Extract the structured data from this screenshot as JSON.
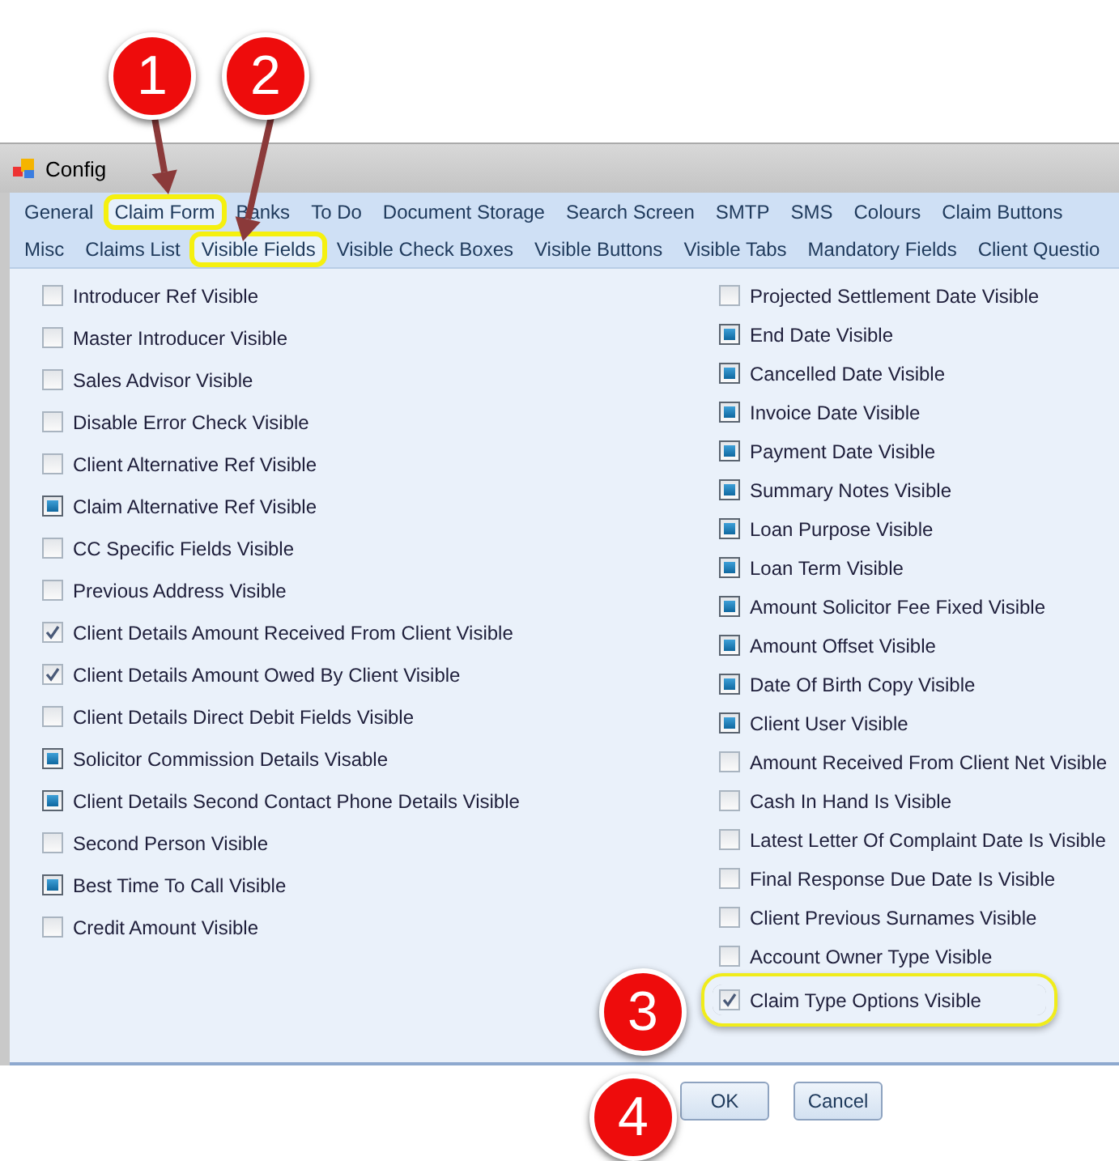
{
  "window": {
    "title": "Config"
  },
  "tab_rows": [
    {
      "tabs": [
        {
          "label": "General",
          "selected": false,
          "highlighted": false
        },
        {
          "label": "Claim Form",
          "selected": true,
          "highlighted": true
        },
        {
          "label": "Banks",
          "selected": false,
          "highlighted": false
        },
        {
          "label": "To Do",
          "selected": false,
          "highlighted": false
        },
        {
          "label": "Document Storage",
          "selected": false,
          "highlighted": false
        },
        {
          "label": "Search Screen",
          "selected": false,
          "highlighted": false
        },
        {
          "label": "SMTP",
          "selected": false,
          "highlighted": false
        },
        {
          "label": "SMS",
          "selected": false,
          "highlighted": false
        },
        {
          "label": "Colours",
          "selected": false,
          "highlighted": false
        },
        {
          "label": "Claim Buttons",
          "selected": false,
          "highlighted": false
        }
      ]
    },
    {
      "tabs": [
        {
          "label": "Misc",
          "selected": false,
          "highlighted": false
        },
        {
          "label": "Claims List",
          "selected": false,
          "highlighted": false
        },
        {
          "label": "Visible Fields",
          "selected": true,
          "highlighted": true
        },
        {
          "label": "Visible Check Boxes",
          "selected": false,
          "highlighted": false
        },
        {
          "label": "Visible Buttons",
          "selected": false,
          "highlighted": false
        },
        {
          "label": "Visible Tabs",
          "selected": false,
          "highlighted": false
        },
        {
          "label": "Mandatory Fields",
          "selected": false,
          "highlighted": false
        },
        {
          "label": "Client Questio",
          "selected": false,
          "highlighted": false
        }
      ]
    }
  ],
  "columns": [
    {
      "options": [
        {
          "label": "Introducer Ref Visible",
          "checked": false,
          "indeterminate": false,
          "highlighted": false
        },
        {
          "label": "Master Introducer Visible",
          "checked": false,
          "indeterminate": false,
          "highlighted": false
        },
        {
          "label": "Sales Advisor Visible",
          "checked": false,
          "indeterminate": false,
          "highlighted": false
        },
        {
          "label": "Disable Error Check Visible",
          "checked": false,
          "indeterminate": false,
          "highlighted": false
        },
        {
          "label": "Client Alternative Ref Visible",
          "checked": false,
          "indeterminate": false,
          "highlighted": false
        },
        {
          "label": "Claim Alternative Ref Visible",
          "checked": false,
          "indeterminate": true,
          "highlighted": false
        },
        {
          "label": "CC Specific Fields Visible",
          "checked": false,
          "indeterminate": false,
          "highlighted": false
        },
        {
          "label": "Previous Address Visible",
          "checked": false,
          "indeterminate": false,
          "highlighted": false
        },
        {
          "label": "Client Details Amount Received From Client Visible",
          "checked": true,
          "indeterminate": false,
          "highlighted": false
        },
        {
          "label": "Client Details Amount Owed By Client Visible",
          "checked": true,
          "indeterminate": false,
          "highlighted": false
        },
        {
          "label": "Client Details Direct Debit Fields Visible",
          "checked": false,
          "indeterminate": false,
          "highlighted": false
        },
        {
          "label": "Solicitor Commission Details Visable",
          "checked": false,
          "indeterminate": true,
          "highlighted": false
        },
        {
          "label": "Client Details Second Contact Phone Details Visible",
          "checked": false,
          "indeterminate": true,
          "highlighted": false
        },
        {
          "label": "Second Person Visible",
          "checked": false,
          "indeterminate": false,
          "highlighted": false
        },
        {
          "label": "Best Time To Call Visible",
          "checked": false,
          "indeterminate": true,
          "highlighted": false
        },
        {
          "label": "Credit Amount Visible",
          "checked": false,
          "indeterminate": false,
          "highlighted": false
        }
      ]
    },
    {
      "options": [
        {
          "label": "Projected Settlement Date Visible",
          "checked": false,
          "indeterminate": false,
          "highlighted": false
        },
        {
          "label": "End Date Visible",
          "checked": false,
          "indeterminate": true,
          "highlighted": false
        },
        {
          "label": "Cancelled Date Visible",
          "checked": false,
          "indeterminate": true,
          "highlighted": false
        },
        {
          "label": "Invoice Date Visible",
          "checked": false,
          "indeterminate": true,
          "highlighted": false
        },
        {
          "label": "Payment Date Visible",
          "checked": false,
          "indeterminate": true,
          "highlighted": false
        },
        {
          "label": "Summary Notes Visible",
          "checked": false,
          "indeterminate": true,
          "highlighted": false
        },
        {
          "label": "Loan Purpose Visible",
          "checked": false,
          "indeterminate": true,
          "highlighted": false
        },
        {
          "label": "Loan Term Visible",
          "checked": false,
          "indeterminate": true,
          "highlighted": false
        },
        {
          "label": "Amount Solicitor Fee Fixed Visible",
          "checked": false,
          "indeterminate": true,
          "highlighted": false
        },
        {
          "label": "Amount Offset Visible",
          "checked": false,
          "indeterminate": true,
          "highlighted": false
        },
        {
          "label": "Date Of Birth Copy Visible",
          "checked": false,
          "indeterminate": true,
          "highlighted": false
        },
        {
          "label": "Client User Visible",
          "checked": false,
          "indeterminate": true,
          "highlighted": false
        },
        {
          "label": "Amount Received From Client Net Visible",
          "checked": false,
          "indeterminate": false,
          "highlighted": false
        },
        {
          "label": "Cash In Hand Is Visible",
          "checked": false,
          "indeterminate": false,
          "highlighted": false
        },
        {
          "label": "Latest Letter Of Complaint Date Is Visible",
          "checked": false,
          "indeterminate": false,
          "highlighted": false
        },
        {
          "label": "Final Response Due Date Is Visible",
          "checked": false,
          "indeterminate": false,
          "highlighted": false
        },
        {
          "label": "Client Previous Surnames Visible",
          "checked": false,
          "indeterminate": false,
          "highlighted": false
        },
        {
          "label": "Account Owner Type Visible",
          "checked": false,
          "indeterminate": false,
          "highlighted": false
        },
        {
          "label": "Claim Type Options Visible",
          "checked": true,
          "indeterminate": false,
          "highlighted": true
        }
      ]
    }
  ],
  "buttons": [
    "OK",
    "Cancel"
  ],
  "callouts": [
    {
      "number": "1"
    },
    {
      "number": "2"
    },
    {
      "number": "3"
    },
    {
      "number": "4"
    }
  ]
}
